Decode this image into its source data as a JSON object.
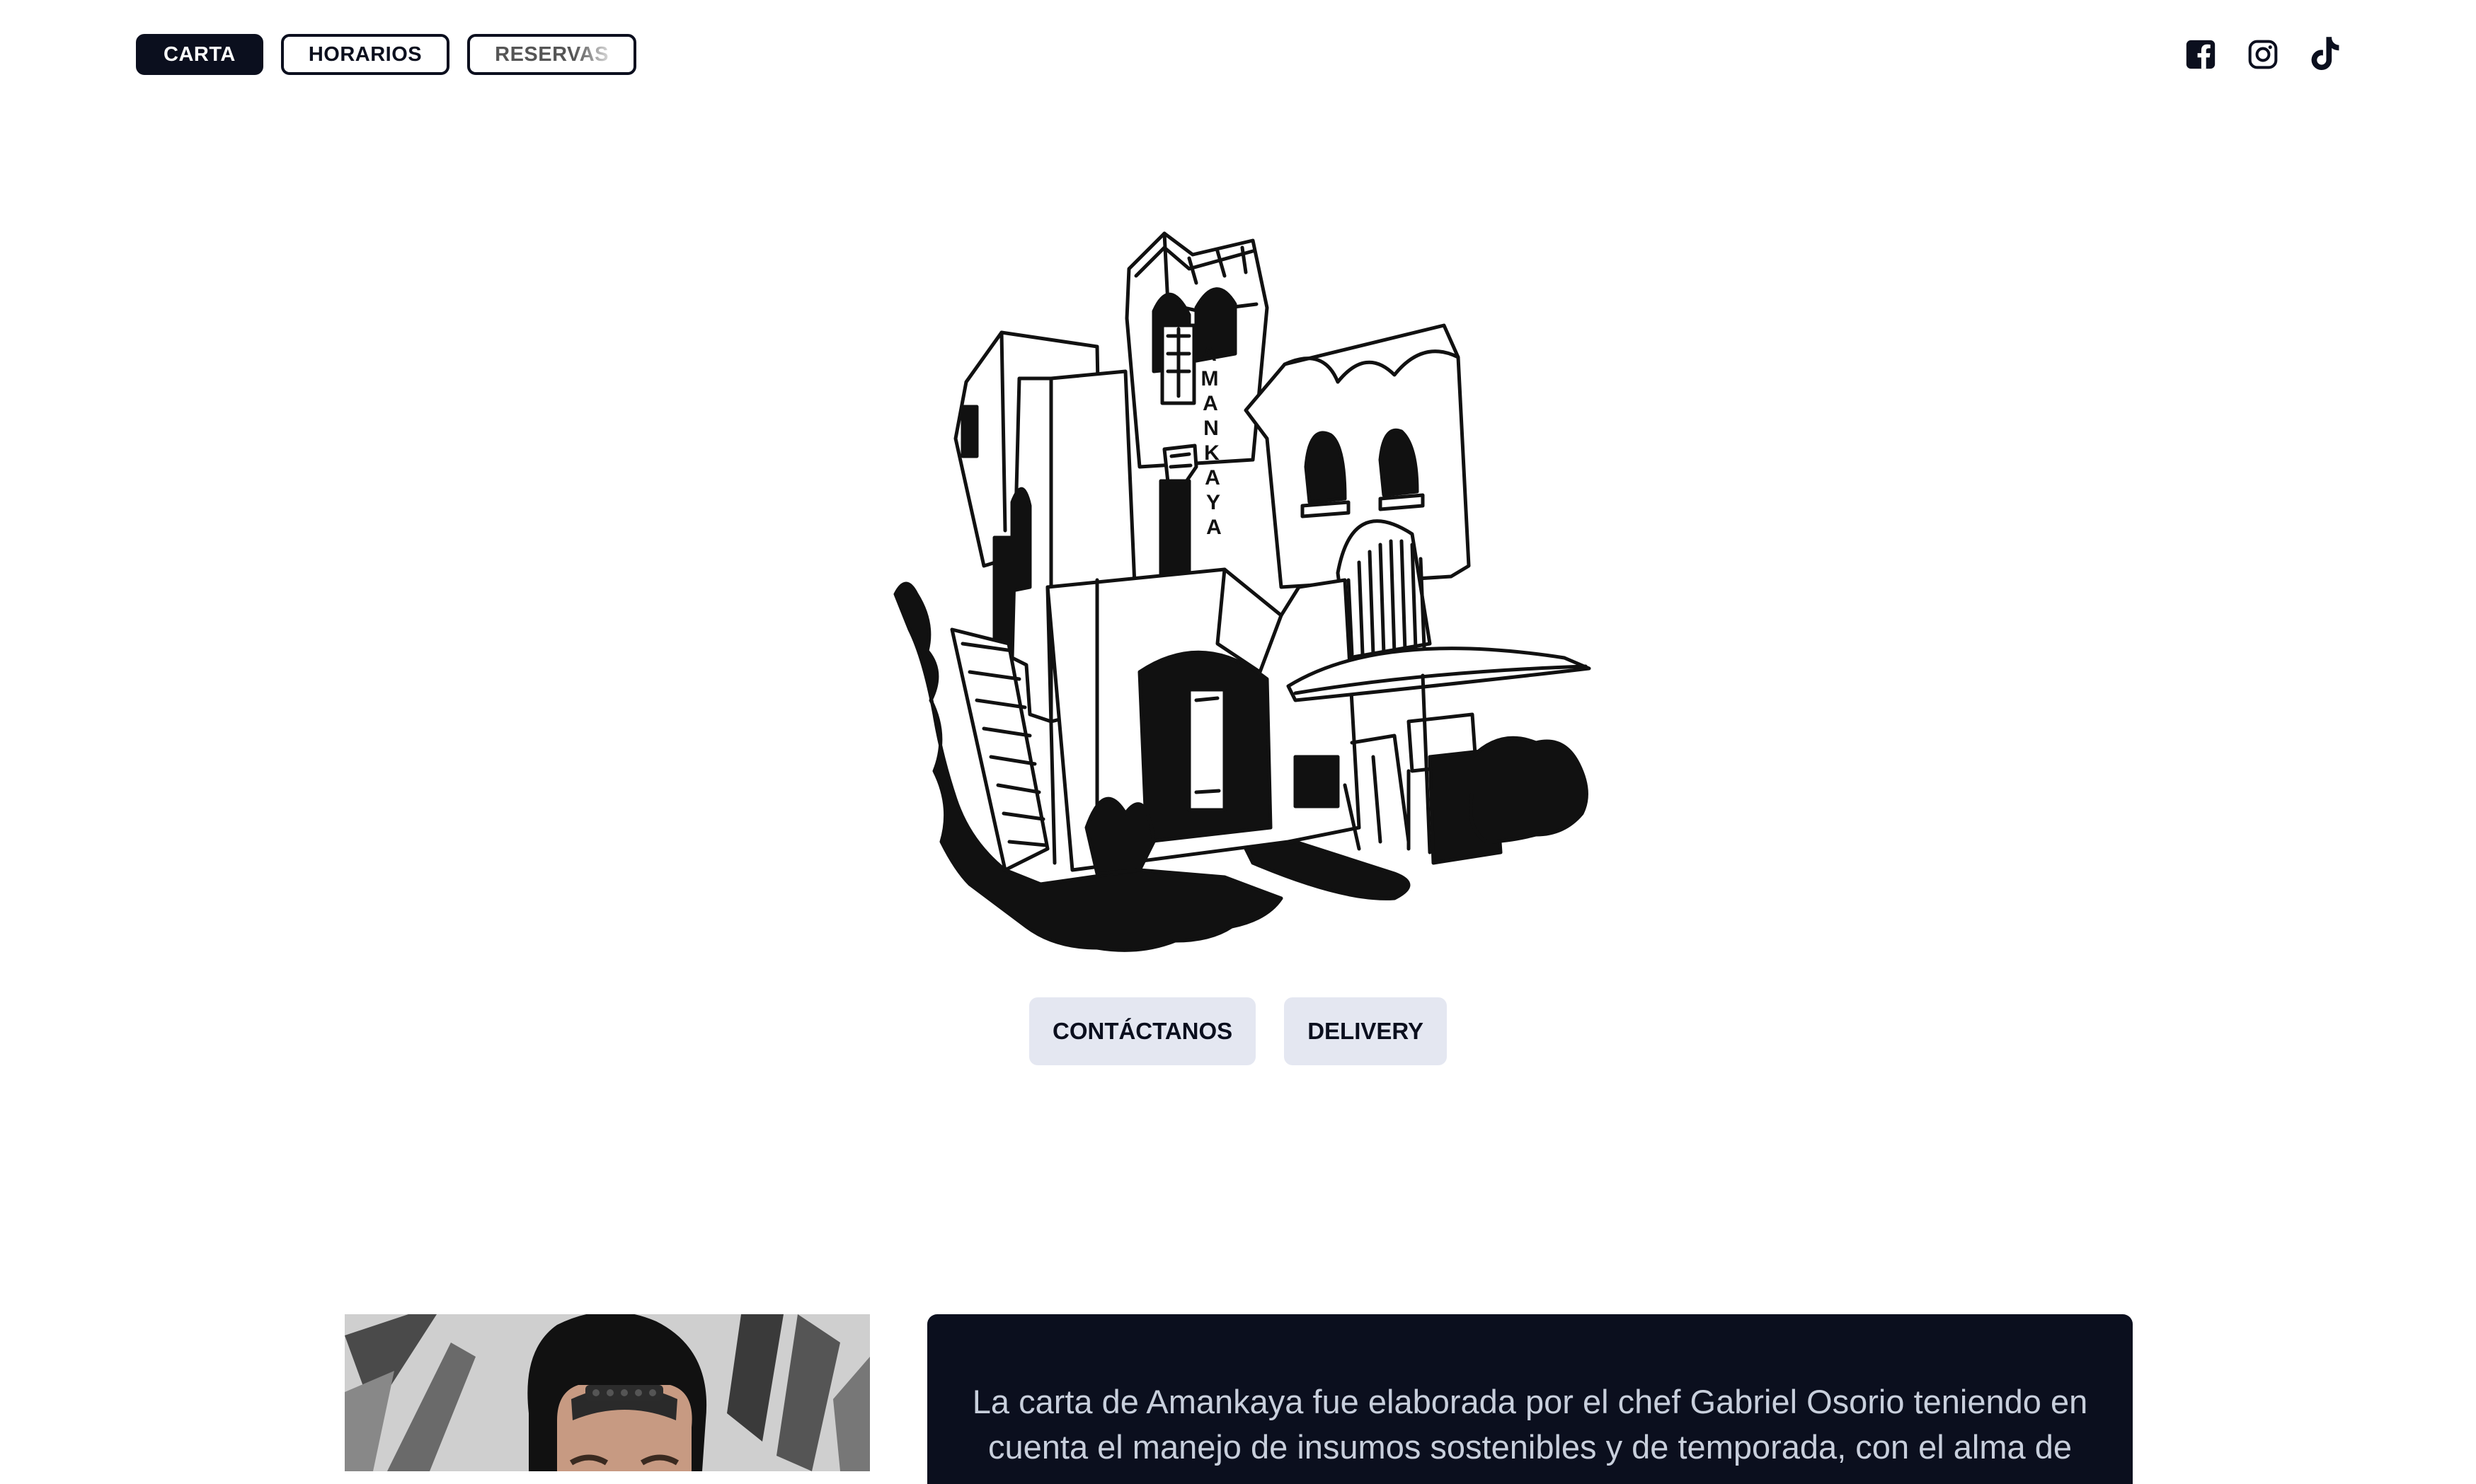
{
  "nav": {
    "items": [
      {
        "label": "CARTA",
        "active": true
      },
      {
        "label": "HORARIOS",
        "active": false
      },
      {
        "label": "RESERVAS",
        "active": false
      }
    ]
  },
  "socials": [
    "facebook-icon",
    "instagram-icon",
    "tiktok-icon"
  ],
  "hero": {
    "image": "amankaya-building-illustration",
    "sign_text": "AMANKAYA"
  },
  "cta": {
    "contact_label": "CONTÁCTANOS",
    "delivery_label": "DELIVERY"
  },
  "about": {
    "photo": "chef-portrait",
    "text": "La carta de Amankaya fue elaborada por el chef Gabriel Osorio teniendo en cuenta el manejo de insumos sostenibles y de temporada, con el alma de"
  },
  "colors": {
    "navy": "#0b0f1e",
    "button_bg": "#e4e7f1",
    "card_text": "#c8cfdc"
  }
}
